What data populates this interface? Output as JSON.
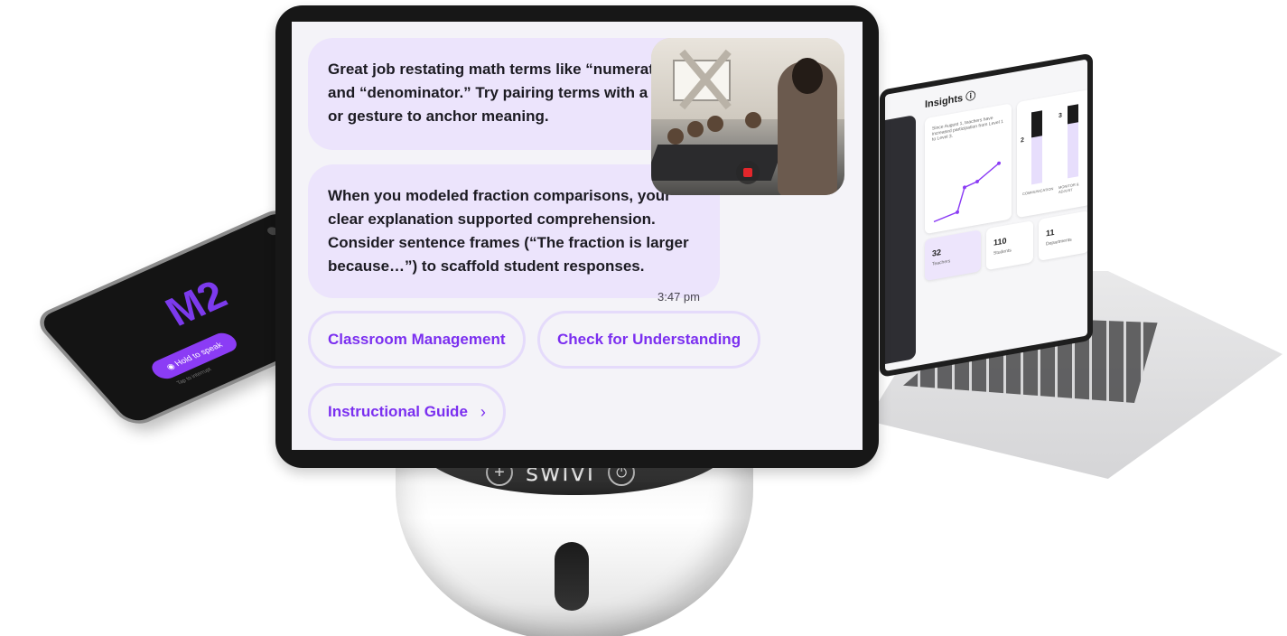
{
  "phone": {
    "logo": "M2",
    "button_label": "◉ Hold to speak",
    "sub_label": "Tap to interrupt"
  },
  "laptop": {
    "title": "Insights ⓘ",
    "summary": "Since August 1, teachers have increased participation from Level 1 to Level 3.",
    "bars": [
      {
        "label": "COMMUNICATION",
        "value": 2,
        "level": 0.35
      },
      {
        "label": "MONITOR & ADJUST",
        "value": 3,
        "level": 0.25
      }
    ],
    "stats": [
      {
        "value": "32",
        "label": "Teachers"
      },
      {
        "value": "110",
        "label": "Students"
      },
      {
        "value": "11",
        "label": "Departments"
      }
    ]
  },
  "tablet": {
    "messages": [
      {
        "text": "Great job restating math terms like “numerator” and “denominator.” Try pairing terms with a visual or gesture to anchor meaning."
      },
      {
        "text": "When you modeled fraction comparisons, your clear explanation supported comprehension. Consider sentence frames (“The fraction is larger because…”) to scaffold student responses.",
        "time": "3:47 pm"
      }
    ],
    "chips": [
      {
        "label": "Classroom Management"
      },
      {
        "label": "Check for Understanding"
      },
      {
        "label": "Instructional Guide",
        "chevron": "›"
      }
    ],
    "video": {
      "record_icon": "stop-record-icon",
      "record_color": "#e3262b"
    }
  },
  "swivl": {
    "logo": "swivl",
    "plus": "+",
    "power": "⏻"
  },
  "colors": {
    "accent": "#7b2ff0",
    "bubble": "#ece4fc",
    "chip_border": "#e5dbfb"
  }
}
